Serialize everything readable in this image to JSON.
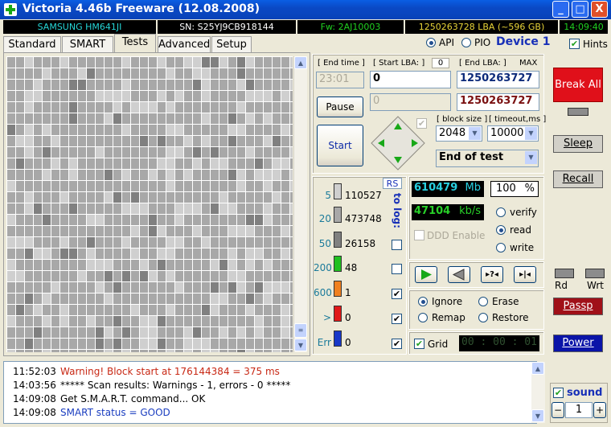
{
  "window": {
    "title": "Victoria 4.46b Freeware (12.08.2008)",
    "minimize": "_",
    "maximize": "□",
    "close": "X"
  },
  "infobar": {
    "model": "SAMSUNG HM641JI",
    "serial": "SN: S25YJ9CB918144",
    "firmware": "Fw: 2AJ10003",
    "lba": "1250263728 LBA (~596 GB)",
    "clock": "14:09:40"
  },
  "tabs": [
    {
      "label": "Standard"
    },
    {
      "label": "SMART"
    },
    {
      "label": "Tests",
      "active": true
    },
    {
      "label": "Advanced"
    },
    {
      "label": "Setup"
    }
  ],
  "mode": {
    "api_label": "API",
    "pio_label": "PIO",
    "device_label": "Device 1",
    "hints_label": "Hints",
    "selected": "API"
  },
  "test": {
    "end_time_label": "[ End time ]",
    "end_time_value": "23:01",
    "start_lba_label": "[ Start LBA: ]",
    "start_lba_small": "0",
    "start_lba_value": "0",
    "end_lba_label": "[ End LBA: ]",
    "max_label": "MAX",
    "end_lba_value": "1250263727",
    "end_lba_current": "1250263727",
    "pause_label": "Pause",
    "start_label": "Start",
    "disabled_field": "0",
    "block_size_label": "[ block size ]",
    "block_size_value": "2048",
    "timeout_label": "[ timeout,ms ]",
    "timeout_value": "10000",
    "end_action": "End of test"
  },
  "stats": {
    "rs_label": "RS",
    "to_log_label": "to log:",
    "rows": [
      {
        "threshold": "5",
        "count": "110527",
        "color": "#cfcfcf",
        "log": false
      },
      {
        "threshold": "20",
        "count": "473748",
        "color": "#a8a8a8",
        "log": false
      },
      {
        "threshold": "50",
        "count": "26158",
        "color": "#808080",
        "log": false
      },
      {
        "threshold": "200",
        "count": "48",
        "color": "#20c020",
        "log": false
      },
      {
        "threshold": "600",
        "count": "1",
        "color": "#f08020",
        "log": true
      },
      {
        "threshold": ">",
        "count": "0",
        "color": "#e01818",
        "log": true
      },
      {
        "threshold": "Err",
        "count": "0",
        "color": "#1838c8",
        "log": true
      }
    ]
  },
  "progress": {
    "mb_value": "610479",
    "mb_unit": "Mb",
    "percent_value": "100",
    "percent_unit": "%",
    "speed_value": "47104",
    "speed_unit": "kb/s",
    "ddd_label": "DDD Enable",
    "verify_label": "verify",
    "read_label": "read",
    "write_label": "write",
    "selected_mode": "read"
  },
  "actions": {
    "ignore": "Ignore",
    "erase": "Erase",
    "remap": "Remap",
    "restore": "Restore",
    "selected": "Ignore"
  },
  "grid": {
    "label": "Grid",
    "timer": "00 : 00 : 01"
  },
  "side": {
    "break_all": "Break All",
    "sleep": "Sleep",
    "recall": "Recall",
    "rd": "Rd",
    "wrt": "Wrt",
    "passp": "Passp",
    "power": "Power",
    "sound": "sound",
    "counter": "1",
    "minus": "−",
    "plus": "+"
  },
  "log": [
    {
      "time": "11:52:03",
      "message": "Warning! Block start at 176144384 = 375 ms",
      "color": "#c82814"
    },
    {
      "time": "14:03:56",
      "message": "***** Scan results: Warnings - 1, errors - 0 *****",
      "color": "#000000"
    },
    {
      "time": "14:09:08",
      "message": "Get S.M.A.R.T. command... OK",
      "color": "#000000"
    },
    {
      "time": "14:09:08",
      "message": "SMART status = GOOD",
      "color": "#1b3ec0"
    }
  ],
  "grid_pattern": {
    "columns": 34,
    "rows": 28,
    "legend_colors": [
      "#cfcfcf",
      "#a8a8a8",
      "#808080"
    ]
  }
}
